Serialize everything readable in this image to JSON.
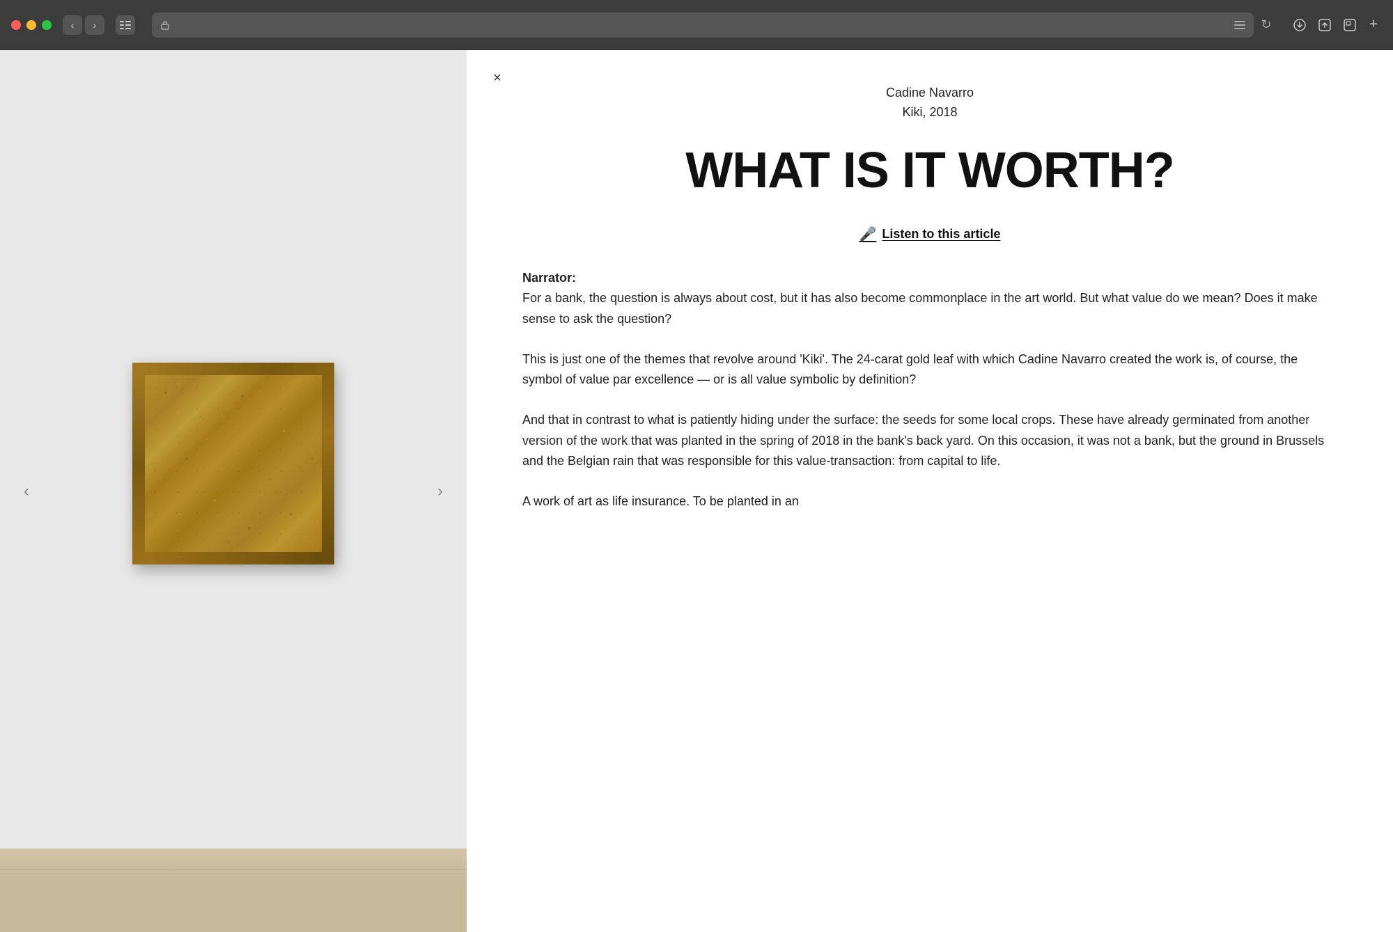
{
  "browser": {
    "address_bar_text": "",
    "nav_back_icon": "‹",
    "nav_forward_icon": "›",
    "sidebar_icon": "⊡",
    "refresh_icon": "↻",
    "download_icon": "↓",
    "share_icon": "↑",
    "fullscreen_icon": "⊞",
    "add_icon": "+"
  },
  "artwork": {
    "nav_left": "‹",
    "nav_right": "›"
  },
  "article": {
    "close_icon": "×",
    "artist": "Cadine Navarro",
    "subtitle": "Kiki, 2018",
    "title": "WHAT IS IT WORTH?",
    "listen_label": "Listen to this article",
    "mic_icon": "🎤",
    "narrator_label": "Narrator:",
    "paragraph1": "For a bank, the question is always about cost, but it has also become commonplace in the art world. But what value do we mean? Does it make sense to ask the question?",
    "paragraph2": "This is just one of the themes that revolve around 'Kiki'. The 24-carat gold leaf with which Cadine Navarro created the work is, of course, the symbol of value par excellence — or is all value symbolic by definition?",
    "paragraph3": "And that in contrast to what is patiently hiding under the surface: the seeds for some local crops. These have already germinated from another version of the work that was planted in the spring of 2018 in the bank's back yard. On this occasion, it was not a bank, but the ground in Brussels and the Belgian rain that was responsible for this value-transaction: from capital to life.",
    "paragraph4": "A work of art as life insurance. To be planted in an"
  }
}
